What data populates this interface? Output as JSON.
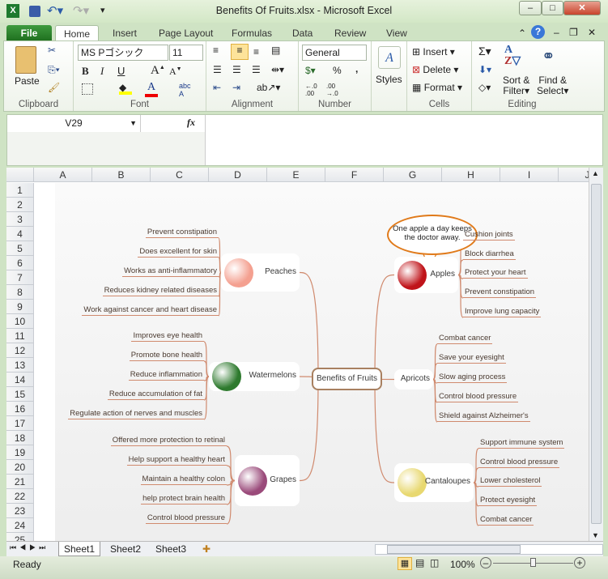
{
  "window": {
    "title": "Benefits Of Fruits.xlsx  -  Microsoft Excel"
  },
  "tabs": [
    "File",
    "Home",
    "Insert",
    "Page Layout",
    "Formulas",
    "Data",
    "Review",
    "View"
  ],
  "ribbon": {
    "clipboard": {
      "label": "Clipboard",
      "paste": "Paste"
    },
    "font": {
      "label": "Font",
      "name": "MS Pゴシック",
      "size": "11"
    },
    "alignment": {
      "label": "Alignment"
    },
    "number": {
      "label": "Number",
      "format": "General",
      "percent": "%",
      "comma": ","
    },
    "styles": {
      "label": "Styles"
    },
    "cells": {
      "label": "Cells",
      "insert": "Insert",
      "delete": "Delete",
      "format": "Format"
    },
    "editing": {
      "label": "Editing",
      "sort": "Sort &",
      "filter": "Filter",
      "find": "Find &",
      "select": "Select"
    }
  },
  "formula_bar": {
    "name_box": "V29",
    "fx": "fx",
    "value": ""
  },
  "columns": [
    "A",
    "B",
    "C",
    "D",
    "E",
    "F",
    "G",
    "H",
    "I",
    "J"
  ],
  "rows": [
    "1",
    "2",
    "3",
    "4",
    "5",
    "6",
    "7",
    "8",
    "9",
    "10",
    "11",
    "12",
    "13",
    "14",
    "15",
    "16",
    "17",
    "18",
    "19",
    "20",
    "21",
    "22",
    "23",
    "24",
    "25"
  ],
  "mindmap": {
    "center": "Benefits of Fruits",
    "callout": "One apple a day keeps the doctor away.",
    "branches": [
      {
        "name": "Peaches",
        "leaves": [
          "Prevent constipation",
          "Does excellent for skin",
          "Works  as  anti-inflammatory",
          "Reduces kidney related diseases",
          "Work against cancer and heart disease"
        ]
      },
      {
        "name": "Watermelons",
        "leaves": [
          "Improves eye health",
          "Promote bone health",
          "Reduce inflammation",
          "Reduce accumulation of fat",
          "Regulate action of nerves and muscles"
        ]
      },
      {
        "name": "Grapes",
        "leaves": [
          "Offered more protection to retinal",
          "Help support a healthy heart",
          "Maintain a healthy colon",
          "help protect brain health",
          "Control blood pressure"
        ]
      },
      {
        "name": "Apples",
        "leaves": [
          "Cushion joints",
          "Block diarrhea",
          "Protect your heart",
          "Prevent constipation",
          "Improve lung capacity"
        ]
      },
      {
        "name": "Apricots",
        "leaves": [
          "Combat cancer",
          "Save your eyesight",
          "Slow aging process",
          "Control blood pressure",
          "Shield against Alzheimer's"
        ]
      },
      {
        "name": "Cantaloupes",
        "leaves": [
          "Support immune system",
          "Control blood pressure",
          "Lower cholesterol",
          "Protect eyesight",
          "Combat cancer"
        ]
      }
    ]
  },
  "sheets": [
    "Sheet1",
    "Sheet2",
    "Sheet3"
  ],
  "status": {
    "ready": "Ready",
    "zoom": "100%",
    "zoom_fraction": 0.5
  },
  "colors": {
    "accent": "#1e6f1e",
    "line": "#d08a6e",
    "callout": "#e07a1a"
  }
}
